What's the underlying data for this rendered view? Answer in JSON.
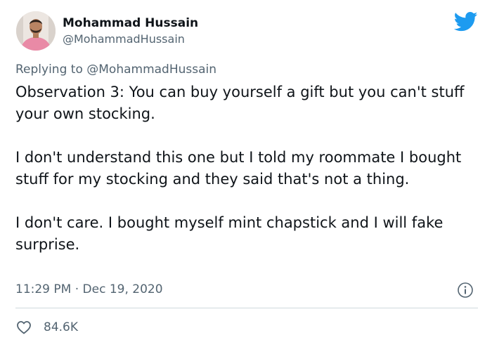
{
  "author": {
    "display_name": "Mohammad Hussain",
    "handle": "@MohammadHussain"
  },
  "reply": {
    "prefix": "Replying to",
    "mention": "@MohammadHussain"
  },
  "tweet": {
    "paragraphs": [
      "Observation 3: You can buy yourself a gift but you can't stuff your own stocking.",
      "I don't understand this one but I told my roommate I bought stuff for my stocking and they said that's not a thing.",
      "I don't care. I bought myself mint chapstick and I will fake surprise."
    ],
    "time": "11:29 PM",
    "separator": "·",
    "date": "Dec 19, 2020"
  },
  "stats": {
    "likes": "84.6K"
  },
  "icons": {
    "brand": "twitter-bird-icon",
    "info": "info-icon",
    "like": "heart-icon"
  },
  "colors": {
    "brand_blue": "#1d9bf0",
    "text_primary": "#0f1419",
    "text_secondary": "#536471",
    "divider": "#cfd9de"
  }
}
